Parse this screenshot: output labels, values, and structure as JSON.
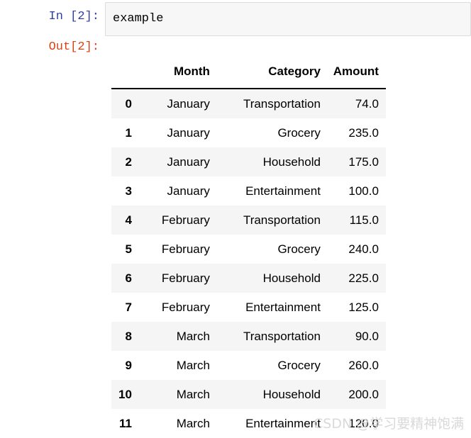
{
  "notebook": {
    "input_prompt": "In [2]:",
    "output_prompt": "Out[2]:",
    "input_code": "example"
  },
  "table": {
    "index_header": "",
    "columns": [
      "Month",
      "Category",
      "Amount"
    ],
    "rows": [
      {
        "index": "0",
        "month": "January",
        "category": "Transportation",
        "amount": "74.0"
      },
      {
        "index": "1",
        "month": "January",
        "category": "Grocery",
        "amount": "235.0"
      },
      {
        "index": "2",
        "month": "January",
        "category": "Household",
        "amount": "175.0"
      },
      {
        "index": "3",
        "month": "January",
        "category": "Entertainment",
        "amount": "100.0"
      },
      {
        "index": "4",
        "month": "February",
        "category": "Transportation",
        "amount": "115.0"
      },
      {
        "index": "5",
        "month": "February",
        "category": "Grocery",
        "amount": "240.0"
      },
      {
        "index": "6",
        "month": "February",
        "category": "Household",
        "amount": "225.0"
      },
      {
        "index": "7",
        "month": "February",
        "category": "Entertainment",
        "amount": "125.0"
      },
      {
        "index": "8",
        "month": "March",
        "category": "Transportation",
        "amount": "90.0"
      },
      {
        "index": "9",
        "month": "March",
        "category": "Grocery",
        "amount": "260.0"
      },
      {
        "index": "10",
        "month": "March",
        "category": "Household",
        "amount": "200.0"
      },
      {
        "index": "11",
        "month": "March",
        "category": "Entertainment",
        "amount": "120.0"
      }
    ]
  },
  "watermark": {
    "text": "CSDN @学习要精神饱满"
  },
  "colors": {
    "in_prompt": "#303F9F",
    "out_prompt": "#D84315",
    "input_cell_bg": "#f7f7f7",
    "stripe_bg": "#f5f5f5",
    "text": "#000000",
    "watermark": "#d9d9d9"
  }
}
